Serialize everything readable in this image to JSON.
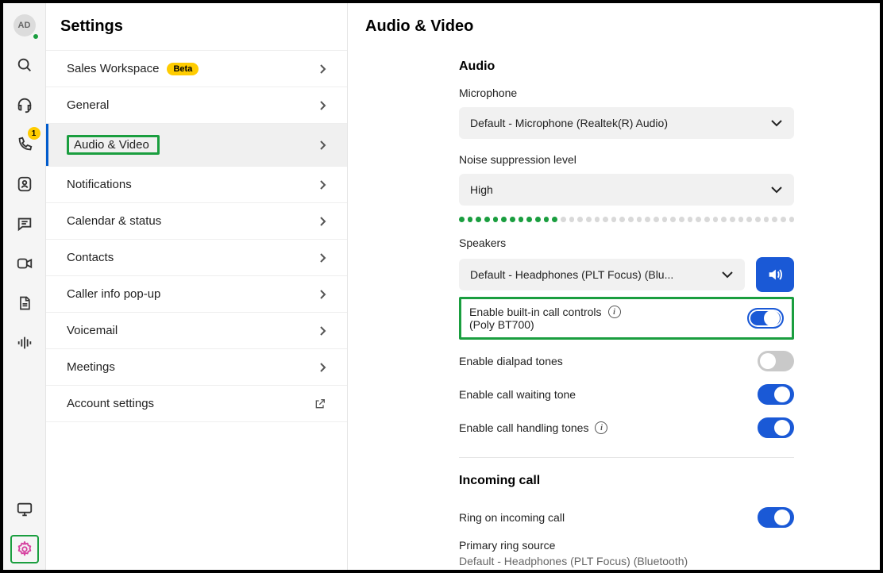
{
  "rail": {
    "avatar_initials": "AD",
    "phone_badge": "1"
  },
  "nav": {
    "title": "Settings",
    "items": [
      {
        "label": "Sales Workspace",
        "beta": "Beta",
        "icon": "chevron"
      },
      {
        "label": "General",
        "icon": "chevron"
      },
      {
        "label": "Audio & Video",
        "icon": "chevron",
        "active": true
      },
      {
        "label": "Notifications",
        "icon": "chevron"
      },
      {
        "label": "Calendar & status",
        "icon": "chevron"
      },
      {
        "label": "Contacts",
        "icon": "chevron"
      },
      {
        "label": "Caller info pop-up",
        "icon": "chevron"
      },
      {
        "label": "Voicemail",
        "icon": "chevron"
      },
      {
        "label": "Meetings",
        "icon": "chevron"
      },
      {
        "label": "Account settings",
        "icon": "external"
      }
    ]
  },
  "main": {
    "title": "Audio & Video",
    "audio_section": "Audio",
    "microphone_label": "Microphone",
    "microphone_value": "Default - Microphone (Realtek(R) Audio)",
    "noise_label": "Noise suppression level",
    "noise_value": "High",
    "level_active_dots": 12,
    "level_total_dots": 40,
    "speakers_label": "Speakers",
    "speakers_value": "Default - Headphones (PLT Focus) (Blu...",
    "builtin_label": "Enable built-in call controls",
    "builtin_sub": "(Poly BT700)",
    "dialpad_label": "Enable dialpad tones",
    "callwaiting_label": "Enable call waiting tone",
    "callhandling_label": "Enable call handling tones",
    "incoming_section": "Incoming call",
    "ring_label": "Ring on incoming call",
    "primary_ring_label": "Primary ring source",
    "primary_ring_value": "Default - Headphones (PLT Focus) (Bluetooth)",
    "toggles": {
      "builtin": true,
      "dialpad": false,
      "callwaiting": true,
      "callhandling": true,
      "ring": true
    }
  }
}
